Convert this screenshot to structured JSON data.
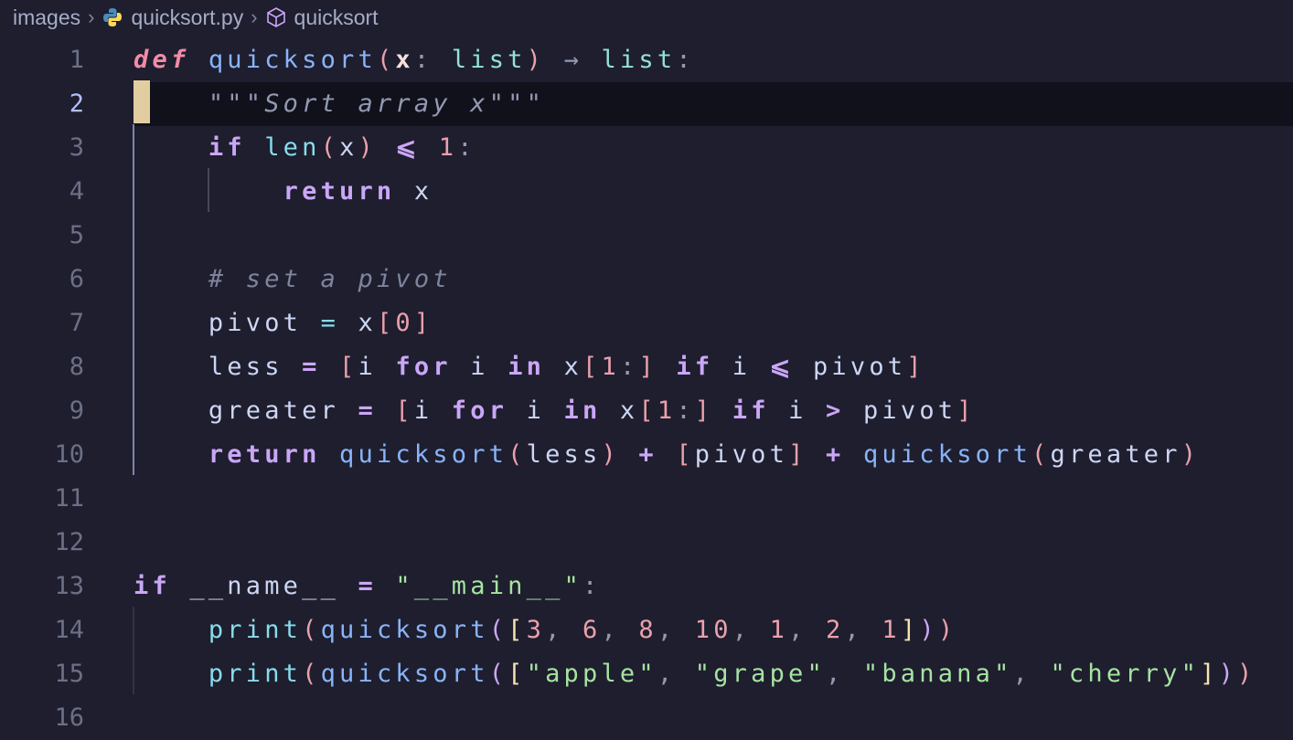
{
  "breadcrumb": {
    "items": [
      {
        "label": "images",
        "icon": null
      },
      {
        "label": "quicksort.py",
        "icon": "python-icon"
      },
      {
        "label": "quicksort",
        "icon": "symbol-module-icon"
      }
    ]
  },
  "editor": {
    "active_line": 2,
    "cursor_color": "#f9e2af",
    "lines": [
      {
        "n": "1",
        "tokens": [
          [
            "def",
            "def"
          ],
          [
            " ",
            ""
          ],
          [
            "quicksort",
            "fn"
          ],
          [
            "(",
            "p1"
          ],
          [
            "x",
            "param"
          ],
          [
            ": ",
            "punc"
          ],
          [
            "list",
            "type"
          ],
          [
            "p1",
            ")"
          ],
          [
            " → ",
            "punc"
          ],
          [
            "list",
            "type"
          ],
          [
            ":",
            "punc"
          ]
        ]
      },
      {
        "n": "2",
        "tokens": [
          [
            "    ",
            ""
          ],
          [
            "\"\"\"Sort array x\"\"\"",
            "doc"
          ]
        ]
      },
      {
        "n": "3",
        "tokens": [
          [
            "    ",
            ""
          ],
          [
            "if",
            "kw"
          ],
          [
            " ",
            ""
          ],
          [
            "len",
            "bi"
          ],
          [
            "(",
            "p1"
          ],
          [
            "x",
            ""
          ],
          [
            ")",
            "p1"
          ],
          [
            " ⩽ ",
            "opk"
          ],
          [
            "1",
            "num"
          ],
          [
            ":",
            "punc"
          ]
        ]
      },
      {
        "n": "4",
        "tokens": [
          [
            "        ",
            ""
          ],
          [
            "return",
            "kw"
          ],
          [
            " x",
            ""
          ]
        ]
      },
      {
        "n": "5",
        "tokens": []
      },
      {
        "n": "6",
        "tokens": [
          [
            "    ",
            ""
          ],
          [
            "# set a pivot",
            "com"
          ]
        ]
      },
      {
        "n": "7",
        "tokens": [
          [
            "    pivot ",
            ""
          ],
          [
            "=",
            "op"
          ],
          [
            " x",
            ""
          ],
          [
            "[",
            "p1"
          ],
          [
            "0",
            "num"
          ],
          [
            "]",
            "p1"
          ]
        ]
      },
      {
        "n": "8",
        "tokens": [
          [
            "    less ",
            ""
          ],
          [
            "=",
            "opk"
          ],
          [
            " ",
            ""
          ],
          [
            "[",
            "p1"
          ],
          [
            "i ",
            ""
          ],
          [
            "for",
            "kw"
          ],
          [
            " i ",
            ""
          ],
          [
            "in",
            "kw"
          ],
          [
            " x",
            ""
          ],
          [
            "[",
            "p1"
          ],
          [
            "1",
            "num"
          ],
          [
            ":",
            "punc"
          ],
          [
            "]",
            "p1"
          ],
          [
            " ",
            ""
          ],
          [
            "if",
            "kw"
          ],
          [
            " i ",
            ""
          ],
          [
            "⩽",
            "opk"
          ],
          [
            " pivot",
            ""
          ],
          [
            "]",
            "p1"
          ]
        ]
      },
      {
        "n": "9",
        "tokens": [
          [
            "    greater ",
            ""
          ],
          [
            "=",
            "opk"
          ],
          [
            " ",
            ""
          ],
          [
            "[",
            "p1"
          ],
          [
            "i ",
            ""
          ],
          [
            "for",
            "kw"
          ],
          [
            " i ",
            ""
          ],
          [
            "in",
            "kw"
          ],
          [
            " x",
            ""
          ],
          [
            "[",
            "p1"
          ],
          [
            "1",
            "num"
          ],
          [
            ":",
            "punc"
          ],
          [
            "]",
            "p1"
          ],
          [
            " ",
            ""
          ],
          [
            "if",
            "kw"
          ],
          [
            " i ",
            ""
          ],
          [
            ">",
            "opk"
          ],
          [
            " pivot",
            ""
          ],
          [
            "]",
            "p1"
          ]
        ]
      },
      {
        "n": "10",
        "tokens": [
          [
            "    ",
            ""
          ],
          [
            "return",
            "kw"
          ],
          [
            " ",
            ""
          ],
          [
            "quicksort",
            "fn"
          ],
          [
            "(",
            "p1"
          ],
          [
            "less",
            ""
          ],
          [
            ")",
            "p1"
          ],
          [
            " ",
            ""
          ],
          [
            "+",
            "opk"
          ],
          [
            " ",
            ""
          ],
          [
            "[",
            "p1"
          ],
          [
            "pivot",
            ""
          ],
          [
            "]",
            "p1"
          ],
          [
            " ",
            ""
          ],
          [
            "+",
            "opk"
          ],
          [
            " ",
            ""
          ],
          [
            "quicksort",
            "fn"
          ],
          [
            "(",
            "p1"
          ],
          [
            "greater",
            ""
          ],
          [
            ")",
            "p1"
          ]
        ]
      },
      {
        "n": "11",
        "tokens": []
      },
      {
        "n": "12",
        "tokens": []
      },
      {
        "n": "13",
        "tokens": [
          [
            "if",
            "kw"
          ],
          [
            " __name__ ",
            ""
          ],
          [
            "=",
            "opk"
          ],
          [
            " ",
            ""
          ],
          [
            "\"__main__\"",
            "str"
          ],
          [
            ":",
            "punc"
          ]
        ]
      },
      {
        "n": "14",
        "tokens": [
          [
            "    ",
            ""
          ],
          [
            "print",
            "bi"
          ],
          [
            "(",
            "p1"
          ],
          [
            "quicksort",
            "fn"
          ],
          [
            "(",
            "p2"
          ],
          [
            "[",
            "p3"
          ],
          [
            "3",
            "num"
          ],
          [
            ", ",
            "punc"
          ],
          [
            "6",
            "num"
          ],
          [
            ", ",
            "punc"
          ],
          [
            "8",
            "num"
          ],
          [
            ", ",
            "punc"
          ],
          [
            "10",
            "num"
          ],
          [
            ", ",
            "punc"
          ],
          [
            "1",
            "num"
          ],
          [
            ", ",
            "punc"
          ],
          [
            "2",
            "num"
          ],
          [
            ", ",
            "punc"
          ],
          [
            "1",
            "num"
          ],
          [
            "]",
            "p3"
          ],
          [
            ")",
            "p2"
          ],
          [
            ")",
            "p1"
          ]
        ]
      },
      {
        "n": "15",
        "tokens": [
          [
            "    ",
            ""
          ],
          [
            "print",
            "bi"
          ],
          [
            "(",
            "p1"
          ],
          [
            "quicksort",
            "fn"
          ],
          [
            "(",
            "p2"
          ],
          [
            "[",
            "p3"
          ],
          [
            "\"apple\"",
            "str"
          ],
          [
            ", ",
            "punc"
          ],
          [
            "\"grape\"",
            "str"
          ],
          [
            ", ",
            "punc"
          ],
          [
            "\"banana\"",
            "str"
          ],
          [
            ", ",
            "punc"
          ],
          [
            "\"cherry\"",
            "str"
          ],
          [
            "]",
            "p3"
          ],
          [
            ")",
            "p2"
          ],
          [
            ")",
            "p1"
          ]
        ]
      },
      {
        "n": "16",
        "tokens": []
      }
    ]
  }
}
